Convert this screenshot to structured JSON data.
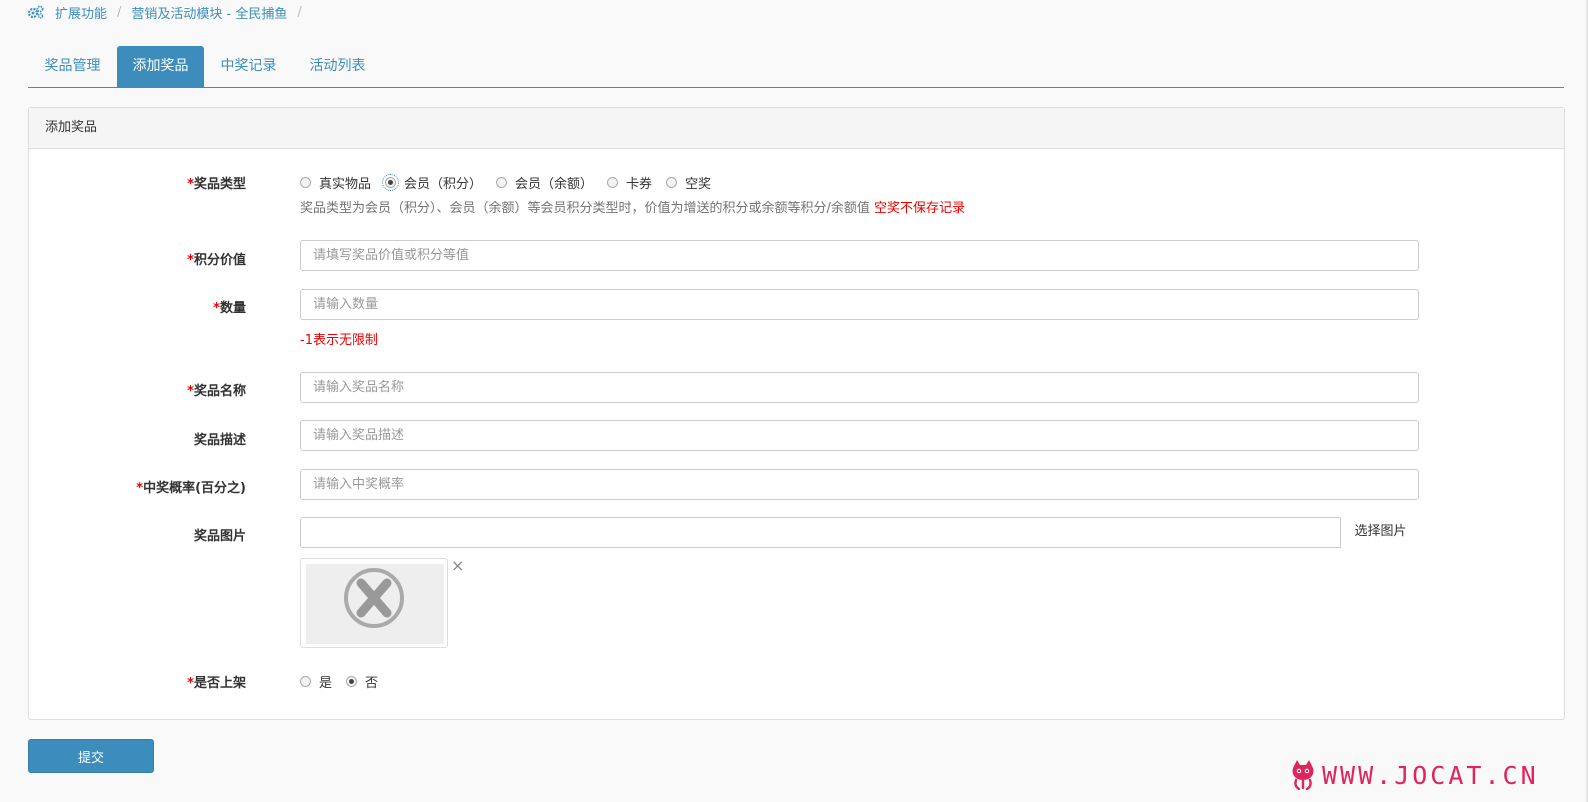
{
  "breadcrumb": {
    "items": [
      "扩展功能",
      "营销及活动模块 - 全民捕鱼"
    ],
    "sep": "/"
  },
  "tabs": [
    {
      "label": "奖品管理",
      "active": false
    },
    {
      "label": "添加奖品",
      "active": true
    },
    {
      "label": "中奖记录",
      "active": false
    },
    {
      "label": "活动列表",
      "active": false
    }
  ],
  "panel": {
    "title": "添加奖品"
  },
  "form": {
    "required_mark": "*",
    "prize_type": {
      "label": "奖品类型",
      "options": [
        "真实物品",
        "会员（积分）",
        "会员（余额）",
        "卡券",
        "空奖"
      ],
      "selected": "会员（积分）",
      "help": "奖品类型为会员（积分）、会员（余额）等会员积分类型时，价值为增送的积分或余额等积分/余额值",
      "help_warning": "空奖不保存记录"
    },
    "points_value": {
      "label": "积分价值",
      "placeholder": "请填写奖品价值或积分等值",
      "value": ""
    },
    "quantity": {
      "label": "数量",
      "placeholder": "请输入数量",
      "value": "",
      "help": "-1表示无限制"
    },
    "prize_name": {
      "label": "奖品名称",
      "placeholder": "请输入奖品名称",
      "value": ""
    },
    "prize_desc": {
      "label": "奖品描述",
      "placeholder": "请输入奖品描述",
      "value": ""
    },
    "win_rate": {
      "label": "中奖概率(百分之)",
      "placeholder": "请输入中奖概率",
      "value": ""
    },
    "prize_image": {
      "label": "奖品图片",
      "button": "选择图片",
      "value": "",
      "remove": "×"
    },
    "on_shelf": {
      "label": "是否上架",
      "options": [
        "是",
        "否"
      ],
      "selected": "否"
    }
  },
  "submit_label": "提交",
  "watermark": "WWW.JOCAT.CN",
  "colors": {
    "primary": "#3c8dbc",
    "required": "#ee0000",
    "watermark": "#e0245e"
  }
}
